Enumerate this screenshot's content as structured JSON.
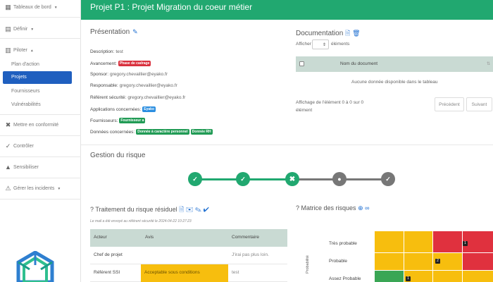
{
  "sidebar": {
    "items": [
      {
        "label": "Tableaux de bord",
        "icon": "dashboard-icon"
      },
      {
        "label": "Définir",
        "icon": "clipboard-icon"
      },
      {
        "label": "Piloter",
        "icon": "chart-icon"
      },
      {
        "label": "Mettre en conformité",
        "icon": "tools-icon"
      },
      {
        "label": "Contrôler",
        "icon": "check-circle-icon"
      },
      {
        "label": "Sensibiliser",
        "icon": "graduation-icon"
      },
      {
        "label": "Gérer les incidents",
        "icon": "warning-icon"
      }
    ],
    "sub_items": [
      "Plan d'action",
      "Projets",
      "Fournisseurs",
      "Vulnérabilités"
    ],
    "active_sub": "Projets"
  },
  "header": {
    "title": "Projet P1 : Projet Migration du coeur métier"
  },
  "presentation": {
    "title": "Présentation",
    "description_label": "Description:",
    "description_value": "test",
    "avancement_label": "Avancement:",
    "avancement_badge": "Phase de cadrage",
    "sponsor_label": "Sponsor:",
    "sponsor_value": "gregory.chevaillier@eyako.fr",
    "responsable_label": "Responsable:",
    "responsable_value": "gregory.chevaillier@eyako.fr",
    "referent_label": "Référent sécurité:",
    "referent_value": "gregory.chevaillier@eyako.fr",
    "applications_label": "Applications concernées:",
    "applications_badge": "Eyako",
    "fournisseurs_label": "Fournisseurs:",
    "fournisseurs_badge": "Fournisseur a",
    "donnees_label": "Données concernées:",
    "donnees_badges": [
      "Donnée à caractère personnel",
      "Donnée RH"
    ]
  },
  "documentation": {
    "title": "Documentation",
    "show_prefix": "Afficher",
    "show_suffix": "éléments",
    "column": "Nom du document",
    "empty": "Aucune donnée disponible dans le tableau",
    "info_line1": "Affichage de l'élément 0 à 0 sur 0",
    "info_line2": "élément",
    "prev": "Précédent",
    "next": "Suivant"
  },
  "risk": {
    "title": "Gestion du risque",
    "steps": [
      {
        "state": "done",
        "icon": "check-icon"
      },
      {
        "state": "done",
        "icon": "check-icon"
      },
      {
        "state": "done",
        "icon": "tools-icon"
      },
      {
        "state": "todo",
        "icon": "head-icon"
      },
      {
        "state": "todo",
        "icon": "shield-check-icon"
      }
    ]
  },
  "treatment": {
    "title": "Traitement du risque résiduel",
    "note": "Le mail a été envoyé au référent sécurité le 2024-04-22 10:27:23",
    "headers": [
      "Acteur",
      "Avis",
      "Commentaire"
    ],
    "rows": [
      {
        "acteur": "Chef de projet",
        "avis": "",
        "commentaire": "J'irai pas plus loin."
      },
      {
        "acteur": "Référent SSI",
        "avis": "Acceptable sous conditions",
        "commentaire": "test"
      }
    ]
  },
  "matrix": {
    "title": "Matrice des risques",
    "rows": [
      "Très probable",
      "Probable",
      "Assez Probable"
    ],
    "axis_label": "Probabilité",
    "colors": {
      "yellow": "#f7be0e",
      "red": "#e0313e",
      "green": "#3aa655"
    },
    "badges": [
      "1",
      "2",
      "1"
    ]
  }
}
